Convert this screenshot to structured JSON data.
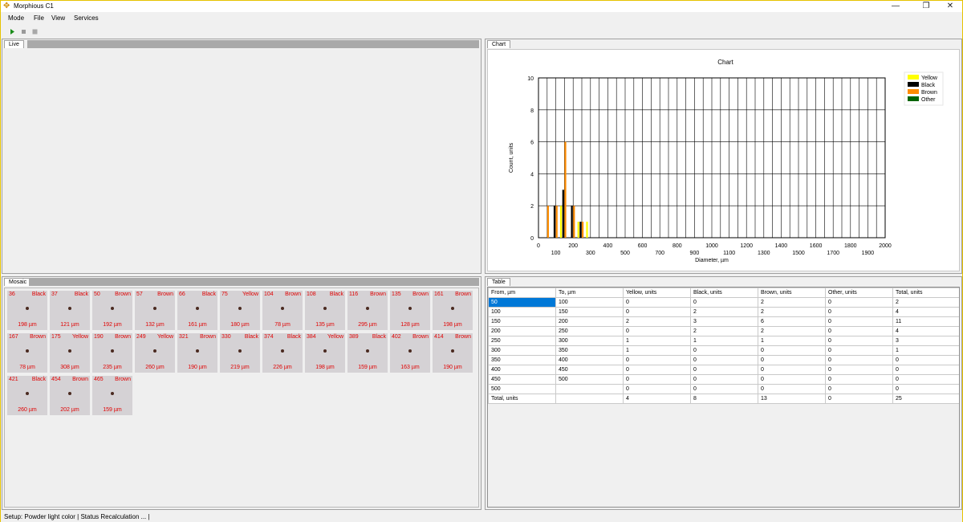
{
  "window": {
    "title": "Morphious C1",
    "minimize_glyph": "—",
    "restore_glyph": "❐",
    "close_glyph": "✕"
  },
  "menu": [
    "Mode",
    "File",
    "View",
    "Services"
  ],
  "toolbar": {
    "buttons": [
      {
        "name": "play-icon",
        "color": "#1a8c1a"
      },
      {
        "name": "pause-icon",
        "color": "#9a9a9a"
      },
      {
        "name": "stop-icon",
        "color": "#9a9a9a"
      }
    ]
  },
  "live": {
    "tab_label": "Live"
  },
  "mosaic": {
    "tab_label": "Mosaic",
    "tiles": [
      {
        "id": "36",
        "color": "Black",
        "size": "198 µm"
      },
      {
        "id": "37",
        "color": "Black",
        "size": "121 µm"
      },
      {
        "id": "50",
        "color": "Brown",
        "size": "192 µm"
      },
      {
        "id": "57",
        "color": "Brown",
        "size": "132 µm"
      },
      {
        "id": "66",
        "color": "Black",
        "size": "161 µm"
      },
      {
        "id": "75",
        "color": "Yellow",
        "size": "180 µm"
      },
      {
        "id": "104",
        "color": "Brown",
        "size": "78 µm"
      },
      {
        "id": "108",
        "color": "Black",
        "size": "135 µm"
      },
      {
        "id": "116",
        "color": "Brown",
        "size": "295 µm"
      },
      {
        "id": "135",
        "color": "Brown",
        "size": "128 µm"
      },
      {
        "id": "161",
        "color": "Brown",
        "size": "198 µm"
      },
      {
        "id": "167",
        "color": "Brown",
        "size": "78 µm"
      },
      {
        "id": "175",
        "color": "Yellow",
        "size": "308 µm"
      },
      {
        "id": "190",
        "color": "Brown",
        "size": "235 µm"
      },
      {
        "id": "249",
        "color": "Yellow",
        "size": "260 µm"
      },
      {
        "id": "321",
        "color": "Brown",
        "size": "190 µm"
      },
      {
        "id": "330",
        "color": "Black",
        "size": "219 µm"
      },
      {
        "id": "374",
        "color": "Black",
        "size": "226 µm"
      },
      {
        "id": "384",
        "color": "Yellow",
        "size": "198 µm"
      },
      {
        "id": "389",
        "color": "Black",
        "size": "159 µm"
      },
      {
        "id": "402",
        "color": "Brown",
        "size": "163 µm"
      },
      {
        "id": "414",
        "color": "Brown",
        "size": "190 µm"
      },
      {
        "id": "421",
        "color": "Black",
        "size": "260 µm"
      },
      {
        "id": "454",
        "color": "Brown",
        "size": "202 µm"
      },
      {
        "id": "465",
        "color": "Brown",
        "size": "159 µm"
      }
    ]
  },
  "chart": {
    "tab_label": "Chart"
  },
  "chart_data": {
    "type": "bar",
    "title": "Chart",
    "xlabel": "Diameter, µm",
    "ylabel": "Count, units",
    "xlim": [
      0,
      2000
    ],
    "ylim": [
      0,
      10
    ],
    "grid": true,
    "legend_position": "top-right",
    "x_ticks_lower": [
      "0",
      "200",
      "400",
      "600",
      "800",
      "1000",
      "1200",
      "1400",
      "1600",
      "1800",
      "2000"
    ],
    "x_ticks_upper": [
      "100",
      "300",
      "500",
      "700",
      "900",
      "1100",
      "1300",
      "1500",
      "1700",
      "1900"
    ],
    "y_ticks": [
      "0",
      "2",
      "4",
      "6",
      "8",
      "10"
    ],
    "bins": [
      50,
      100,
      150,
      200,
      250,
      300,
      350,
      400,
      450,
      500
    ],
    "series": [
      {
        "name": "Yellow",
        "color": "#ffff00",
        "values": [
          0,
          0,
          2,
          0,
          1,
          1,
          0,
          0,
          0,
          0
        ]
      },
      {
        "name": "Black",
        "color": "#000000",
        "values": [
          0,
          2,
          3,
          2,
          1,
          0,
          0,
          0,
          0,
          0
        ]
      },
      {
        "name": "Brown",
        "color": "#ff8c00",
        "values": [
          2,
          2,
          6,
          2,
          1,
          0,
          0,
          0,
          0,
          0
        ]
      },
      {
        "name": "Other",
        "color": "#006400",
        "values": [
          0,
          0,
          0,
          0,
          0,
          0,
          0,
          0,
          0,
          0
        ]
      }
    ]
  },
  "table": {
    "tab_label": "Table",
    "headers": [
      "From, µm",
      "To, µm",
      "Yellow, units",
      "Black, units",
      "Brown, units",
      "Other, units",
      "Total, units"
    ],
    "rows": [
      [
        "50",
        "100",
        "0",
        "0",
        "2",
        "0",
        "2"
      ],
      [
        "100",
        "150",
        "0",
        "2",
        "2",
        "0",
        "4"
      ],
      [
        "150",
        "200",
        "2",
        "3",
        "6",
        "0",
        "11"
      ],
      [
        "200",
        "250",
        "0",
        "2",
        "2",
        "0",
        "4"
      ],
      [
        "250",
        "300",
        "1",
        "1",
        "1",
        "0",
        "3"
      ],
      [
        "300",
        "350",
        "1",
        "0",
        "0",
        "0",
        "1"
      ],
      [
        "350",
        "400",
        "0",
        "0",
        "0",
        "0",
        "0"
      ],
      [
        "400",
        "450",
        "0",
        "0",
        "0",
        "0",
        "0"
      ],
      [
        "450",
        "500",
        "0",
        "0",
        "0",
        "0",
        "0"
      ],
      [
        "500",
        "",
        "0",
        "0",
        "0",
        "0",
        "0"
      ],
      [
        "Total, units",
        "",
        "4",
        "8",
        "13",
        "0",
        "25"
      ]
    ]
  },
  "status": {
    "text": "Setup: Powder light color  |  Status  Recalculation ...  |"
  }
}
